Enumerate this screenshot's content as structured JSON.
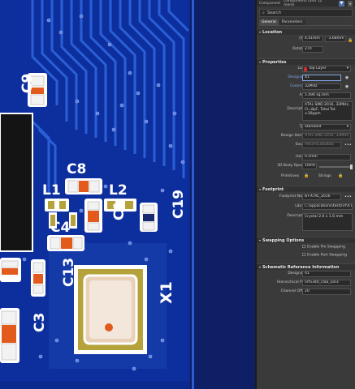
{
  "pcb": {
    "designators": {
      "c9": "C9",
      "c8": "C8",
      "l1": "L1",
      "l2": "L2",
      "c4": "C4",
      "c1": "C1",
      "c19": "C19",
      "c13": "C13",
      "c3": "C3",
      "x1": "X1"
    },
    "colors": {
      "board": "#0b2a8f",
      "trace": "#2457c9",
      "pad": "#f2f2f2",
      "smd": "#e25a1c",
      "copper": "#b5a23a",
      "silkscreen": "#ffffff"
    }
  },
  "panel": {
    "header": {
      "left": "Component",
      "right": "Components (and 12 more)"
    },
    "search": {
      "icon": "search-icon",
      "placeholder": "Search"
    },
    "tabs": [
      "General",
      "Parameters"
    ],
    "location": {
      "title": "Location",
      "xy_label": "(X/Y)",
      "x": "4.41mm",
      "y": "-3.68mm",
      "rotation_label": "Rotation",
      "rotation": "270"
    },
    "properties": {
      "title": "Properties",
      "layer_label": "Layer",
      "layer": "Top Layer",
      "layer_color": "#d12a2a",
      "designator_label": "Designator",
      "designator": "X1",
      "comment_label": "Comment",
      "comment": "32MHz",
      "area_label": "Area",
      "area": "5.494 sq.mm",
      "description_label": "Description",
      "description": "XTAL SMD 2016, 32MHz, Cl=8pF, Total Tol: ±30ppm",
      "type_label": "Type",
      "type": "Standard",
      "design_item_label": "Design Item ID",
      "design_item": "XTAL SMD 2016, 32MHz, 8pF",
      "source_label": "Source",
      "source": "Altium\\Lib\\Dblib",
      "height_label": "Height",
      "height": "0.5mm",
      "opacity_label": "3D Body Opacity",
      "opacity": "100%",
      "primitives_label": "Primitives",
      "strings_label": "Strings"
    },
    "footprint": {
      "title": "Footprint",
      "name_label": "Footprint Name",
      "name": "BT-XTAL_2016",
      "library_label": "Library",
      "library": "C:\\applications\\test\\nrf\\XTAL",
      "description_label": "Description",
      "description": "Crystal 2.0 x 1.6 mm"
    },
    "swapping": {
      "title": "Swapping Options",
      "pin_swap": "Enable Pin Swapping",
      "part_swap": "Enable Part Swapping"
    },
    "schematic": {
      "title": "Schematic Reference Information",
      "designator_label": "Designator",
      "designator": "X1",
      "hier_label": "Hierarchical Path",
      "hier": "nrf5340_claa_var3",
      "channel_label": "Channel Offset",
      "channel": "20"
    }
  }
}
